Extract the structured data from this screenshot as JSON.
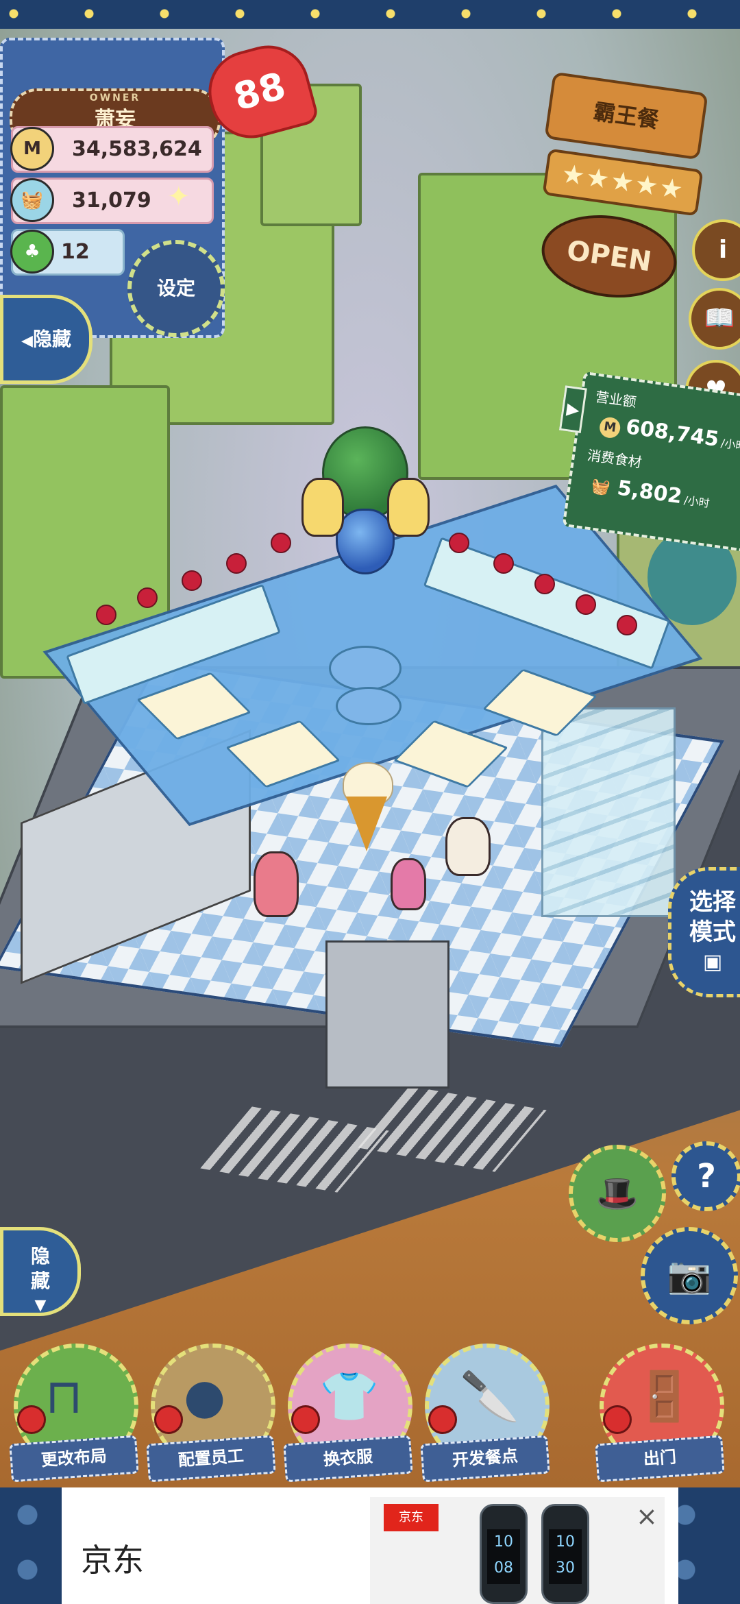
{
  "owner": {
    "label": "OWNER",
    "name": "萧妄",
    "hearts": "88"
  },
  "stats": {
    "coins": "34,583,624",
    "ingredients": "31,079",
    "clovers": "12"
  },
  "buttons": {
    "settings": "设定",
    "hide_top": "隐藏",
    "hide_bottom_line1": "隐",
    "hide_bottom_line2": "藏",
    "mode_line1": "选择",
    "mode_line2": "模式",
    "info": "i",
    "help": "?"
  },
  "shop": {
    "name": "霸王餐",
    "stars": "★★★★★",
    "status": "OPEN"
  },
  "income": {
    "revenue_label": "营业额",
    "revenue": "608,745",
    "revenue_unit": "/小时",
    "consumed_label": "消费食材",
    "consumed": "5,802",
    "consumed_unit": "/小时"
  },
  "dock": [
    {
      "label": "更改布局"
    },
    {
      "label": "配置员工"
    },
    {
      "label": "换衣服"
    },
    {
      "label": "开发餐点"
    },
    {
      "label": "出门"
    }
  ],
  "ad": {
    "title": "京东",
    "logo": "京东",
    "band1": "10\n08",
    "band2": "10\n30",
    "close": "×"
  },
  "colors": {
    "accent": "#e4e07b",
    "panel": "#3f66a4",
    "heart": "#e53f3f"
  }
}
